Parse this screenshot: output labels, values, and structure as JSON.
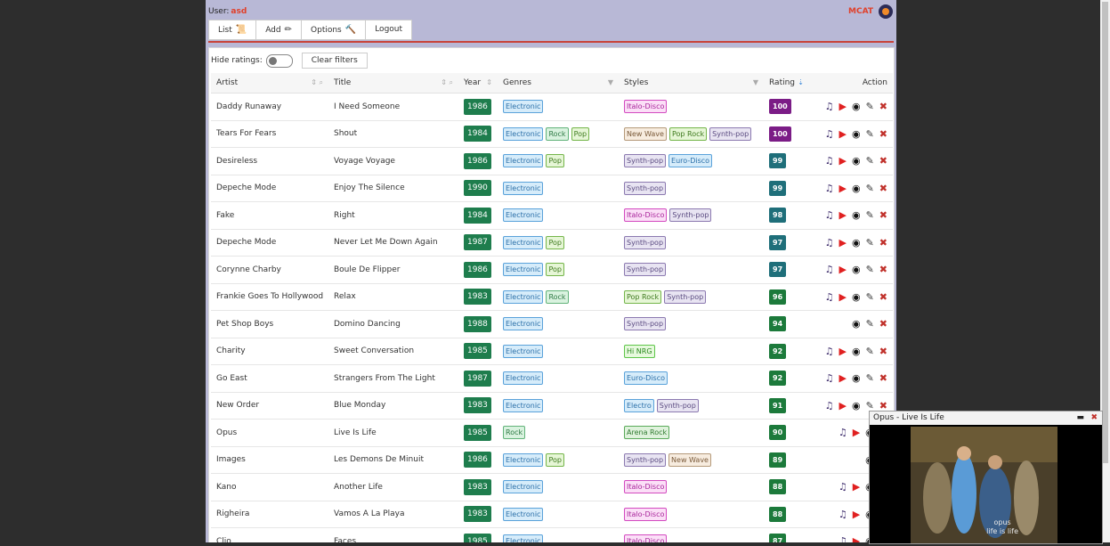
{
  "user": {
    "label": "User:",
    "name": "asd"
  },
  "brand": {
    "name": "MCAT"
  },
  "nav": [
    {
      "label": "List",
      "icon": "scroll-icon",
      "glyph": "📜"
    },
    {
      "label": "Add",
      "icon": "pencil-icon",
      "glyph": "✏"
    },
    {
      "label": "Options",
      "icon": "hammer-icon",
      "glyph": "🔨"
    },
    {
      "label": "Logout"
    }
  ],
  "toolbar": {
    "hide_ratings_label": "Hide ratings:",
    "clear_filters_label": "Clear filters"
  },
  "columns": {
    "artist": "Artist",
    "title": "Title",
    "year": "Year",
    "genres": "Genres",
    "styles": "Styles",
    "rating": "Rating",
    "action": "Action"
  },
  "rows": [
    {
      "artist": "Daddy Runaway",
      "title": "I Need Someone",
      "year": "1986",
      "genres": [
        "Electronic"
      ],
      "styles": [
        "Italo-Disco"
      ],
      "rating": "100",
      "actions": [
        "music",
        "youtube",
        "discogs",
        "edit",
        "delete"
      ]
    },
    {
      "artist": "Tears For Fears",
      "title": "Shout",
      "year": "1984",
      "genres": [
        "Electronic",
        "Rock",
        "Pop"
      ],
      "styles": [
        "New Wave",
        "Pop Rock",
        "Synth-pop"
      ],
      "rating": "100",
      "actions": [
        "music",
        "youtube",
        "discogs",
        "edit",
        "delete"
      ]
    },
    {
      "artist": "Desireless",
      "title": "Voyage Voyage",
      "year": "1986",
      "genres": [
        "Electronic",
        "Pop"
      ],
      "styles": [
        "Synth-pop",
        "Euro-Disco"
      ],
      "rating": "99",
      "actions": [
        "music",
        "youtube",
        "discogs",
        "edit",
        "delete"
      ]
    },
    {
      "artist": "Depeche Mode",
      "title": "Enjoy The Silence",
      "year": "1990",
      "genres": [
        "Electronic"
      ],
      "styles": [
        "Synth-pop"
      ],
      "rating": "99",
      "actions": [
        "music",
        "youtube",
        "discogs",
        "edit",
        "delete"
      ]
    },
    {
      "artist": "Fake",
      "title": "Right",
      "year": "1984",
      "genres": [
        "Electronic"
      ],
      "styles": [
        "Italo-Disco",
        "Synth-pop"
      ],
      "rating": "98",
      "actions": [
        "music",
        "youtube",
        "discogs",
        "edit",
        "delete"
      ]
    },
    {
      "artist": "Depeche Mode",
      "title": "Never Let Me Down Again",
      "year": "1987",
      "genres": [
        "Electronic",
        "Pop"
      ],
      "styles": [
        "Synth-pop"
      ],
      "rating": "97",
      "actions": [
        "music",
        "youtube",
        "discogs",
        "edit",
        "delete"
      ]
    },
    {
      "artist": "Corynne Charby",
      "title": "Boule De Flipper",
      "year": "1986",
      "genres": [
        "Electronic",
        "Pop"
      ],
      "styles": [
        "Synth-pop"
      ],
      "rating": "97",
      "actions": [
        "music",
        "youtube",
        "discogs",
        "edit",
        "delete"
      ]
    },
    {
      "artist": "Frankie Goes To Hollywood",
      "title": "Relax",
      "year": "1983",
      "genres": [
        "Electronic",
        "Rock"
      ],
      "styles": [
        "Pop Rock",
        "Synth-pop"
      ],
      "rating": "96",
      "actions": [
        "music",
        "youtube",
        "discogs",
        "edit",
        "delete"
      ]
    },
    {
      "artist": "Pet Shop Boys",
      "title": "Domino Dancing",
      "year": "1988",
      "genres": [
        "Electronic"
      ],
      "styles": [
        "Synth-pop"
      ],
      "rating": "94",
      "actions": [
        "discogs",
        "edit",
        "delete"
      ]
    },
    {
      "artist": "Charity",
      "title": "Sweet Conversation",
      "year": "1985",
      "genres": [
        "Electronic"
      ],
      "styles": [
        "Hi NRG"
      ],
      "rating": "92",
      "actions": [
        "music",
        "youtube",
        "discogs",
        "edit",
        "delete"
      ]
    },
    {
      "artist": "Go East",
      "title": "Strangers From The Light",
      "year": "1987",
      "genres": [
        "Electronic"
      ],
      "styles": [
        "Euro-Disco"
      ],
      "rating": "92",
      "actions": [
        "music",
        "youtube",
        "discogs",
        "edit",
        "delete"
      ]
    },
    {
      "artist": "New Order",
      "title": "Blue Monday",
      "year": "1983",
      "genres": [
        "Electronic"
      ],
      "styles": [
        "Electro",
        "Synth-pop"
      ],
      "rating": "91",
      "actions": [
        "music",
        "youtube",
        "discogs",
        "edit",
        "delete"
      ]
    },
    {
      "artist": "Opus",
      "title": "Live Is Life",
      "year": "1985",
      "genres": [
        "Rock"
      ],
      "styles": [
        "Arena Rock"
      ],
      "rating": "90",
      "actions": [
        "music",
        "youtube",
        "discogs",
        "edit"
      ]
    },
    {
      "artist": "Images",
      "title": "Les Demons De Minuit",
      "year": "1986",
      "genres": [
        "Electronic",
        "Pop"
      ],
      "styles": [
        "Synth-pop",
        "New Wave"
      ],
      "rating": "89",
      "actions": [
        "discogs",
        "edit"
      ]
    },
    {
      "artist": "Kano",
      "title": "Another Life",
      "year": "1983",
      "genres": [
        "Electronic"
      ],
      "styles": [
        "Italo-Disco"
      ],
      "rating": "88",
      "actions": [
        "music",
        "youtube",
        "discogs",
        "edit"
      ]
    },
    {
      "artist": "Righeira",
      "title": "Vamos A La Playa",
      "year": "1983",
      "genres": [
        "Electronic"
      ],
      "styles": [
        "Italo-Disco"
      ],
      "rating": "88",
      "actions": [
        "music",
        "youtube",
        "discogs",
        "edit"
      ]
    },
    {
      "artist": "Clio",
      "title": "Faces",
      "year": "1985",
      "genres": [
        "Electronic"
      ],
      "styles": [
        "Italo-Disco"
      ],
      "rating": "87",
      "actions": [
        "music",
        "youtube",
        "discogs",
        "edit"
      ]
    }
  ],
  "colors": {
    "year_bg": "#1e7d4d",
    "rating_100": "#7b1c86",
    "rating_teal": "#1f6f7a",
    "rating_green": "#1c7a3b",
    "brand_red": "#e0402a"
  },
  "tag_styles": {
    "Electronic": {
      "bg": "#d6ecfa",
      "border": "#5aa2da",
      "color": "#2a6fa8"
    },
    "Rock": {
      "bg": "#d9f2df",
      "border": "#62b37a",
      "color": "#2f7a45"
    },
    "Pop": {
      "bg": "#e6f6d6",
      "border": "#74b54a",
      "color": "#3e7a1e"
    },
    "Italo-Disco": {
      "bg": "#fbdff7",
      "border": "#d34ac0",
      "color": "#a8249a"
    },
    "New Wave": {
      "bg": "#f7ecdf",
      "border": "#b59a7a",
      "color": "#7a5a3a"
    },
    "Pop Rock": {
      "bg": "#e6f6d6",
      "border": "#74b54a",
      "color": "#3e7a1e"
    },
    "Synth-pop": {
      "bg": "#e8e4f2",
      "border": "#8c7ab0",
      "color": "#5a4a80"
    },
    "Euro-Disco": {
      "bg": "#d6ecfa",
      "border": "#5aa2da",
      "color": "#2a6fa8"
    },
    "Hi NRG": {
      "bg": "#e6f9dd",
      "border": "#5ec64a",
      "color": "#2a8a1e"
    },
    "Electro": {
      "bg": "#d6ecfa",
      "border": "#5aa2da",
      "color": "#2a6fa8"
    },
    "Arena Rock": {
      "bg": "#dff2dc",
      "border": "#5aaa5a",
      "color": "#2f7a2f"
    }
  },
  "video": {
    "title": "Opus - Live Is Life",
    "caption_line1": "opus",
    "caption_line2": "life is life"
  }
}
